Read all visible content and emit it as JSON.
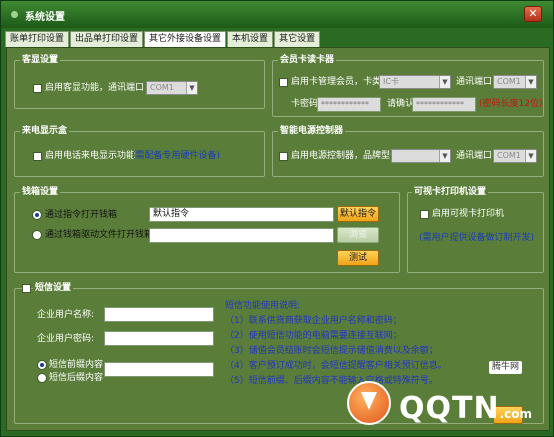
{
  "window": {
    "title": "系统设置",
    "close_glyph": "✕"
  },
  "tabs": [
    {
      "label": "账单打印设置",
      "active": false
    },
    {
      "label": "出品单打印设置",
      "active": false
    },
    {
      "label": "其它外接设备设置",
      "active": true
    },
    {
      "label": "本机设置",
      "active": false
    },
    {
      "label": "其它设置",
      "active": false
    }
  ],
  "guest_display": {
    "title": "客显设置",
    "enable_label": "启用客显功能，通讯端口",
    "enabled": false,
    "port": "COM1"
  },
  "card_reader": {
    "title": "会员卡读卡器",
    "enable_label": "启用卡管理会员，卡类型",
    "enabled": false,
    "card_type": "IC卡",
    "port_label": "通讯端口",
    "port": "COM1",
    "password_label": "卡密码",
    "password_value": "************",
    "confirm_label": "请确认",
    "confirm_value": "************",
    "password_hint": "(密码长度12位)"
  },
  "caller_id": {
    "title": "来电显示盒",
    "enable_label": "启用电话来电显示功能",
    "enabled": false,
    "hint": "(需配备专用硬件设备)"
  },
  "power_controller": {
    "title": "智能电源控制器",
    "enable_label": "启用电源控制器，品牌型号",
    "enabled": false,
    "model": "",
    "port_label": "通讯端口",
    "port": "COM1"
  },
  "cash_drawer": {
    "title": "钱箱设置",
    "opt_command_label": "通过指令打开钱箱",
    "opt_command_selected": true,
    "command_value": "默认指令",
    "default_button": "默认指令",
    "opt_file_label": "通过钱箱驱动文件打开钱箱",
    "opt_file_selected": false,
    "file_value": "",
    "browse_button": "浏览",
    "test_button": "测试"
  },
  "visual_card_printer": {
    "title": "可视卡打印机设置",
    "enable_label": "启用可视卡打印机",
    "enabled": false,
    "hint": "(需用户提供设备做订制开发)"
  },
  "sms": {
    "title": "短信设置",
    "enabled": false,
    "user_label": "企业用户名称:",
    "user_value": "",
    "password_label": "企业用户密码:",
    "password_value": "",
    "prefix_label": "短信前缀内容",
    "prefix_selected": true,
    "suffix_label": "短信后缀内容",
    "suffix_selected": false,
    "content_value": "",
    "help_title": "短信功能使用说明:",
    "help_lines": [
      "（1）联系供货商获取企业用户名称和密码；",
      "（2）使用短信功能的电脑需要连接互联网；",
      "（3）储值会员结账时会短信提示储值消费以及余额；",
      "（4）客户预订成功时，会短信提醒客户相关预订信息。",
      "（5）短信前缀、后缀内容不能输入空格或特殊符号。"
    ]
  },
  "watermark": {
    "brand": "QQTN",
    "suffix": ".com",
    "tag": "腾牛网"
  }
}
